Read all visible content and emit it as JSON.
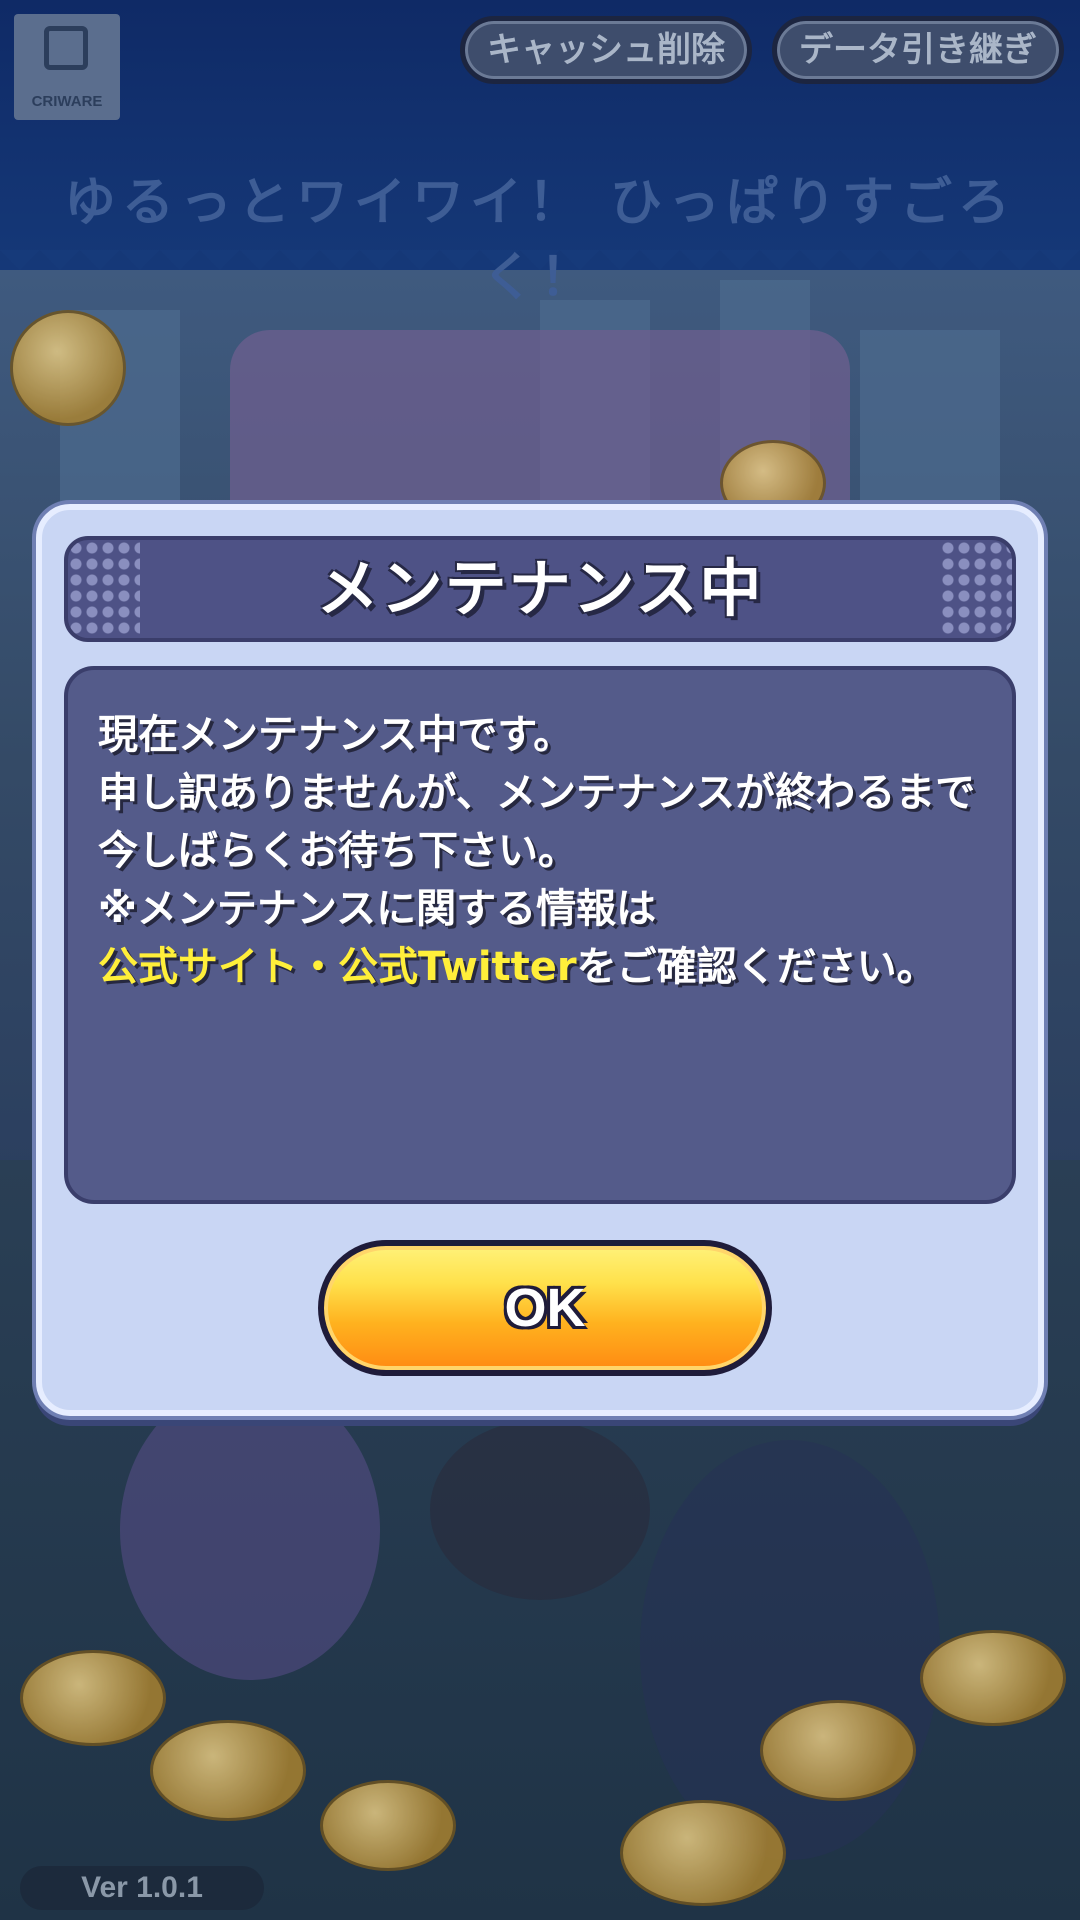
{
  "header": {
    "logo_label": "CRIWARE",
    "cache_button_label": "キャッシュ削除",
    "data_transfer_button_label": "データ引き継ぎ"
  },
  "background": {
    "tagline": "ゆるっとワイワイ！ ひっぱりすごろく！"
  },
  "dialog": {
    "title": "メンテナンス中",
    "message": {
      "line1": "現在メンテナンス中です。",
      "line2": "申し訳ありませんが、メンテナンスが終わるまで",
      "line3": "今しばらくお待ち下さい。",
      "line4": "※メンテナンスに関する情報は",
      "line5_highlight": "公式サイト・公式Twitter",
      "line5_rest": "をご確認ください。"
    },
    "ok_label": "OK"
  },
  "footer": {
    "version": "Ver 1.0.1"
  },
  "colors": {
    "highlight": "#ffef3a",
    "ok_button": "#ffb21f",
    "panel": "#545b8a"
  }
}
